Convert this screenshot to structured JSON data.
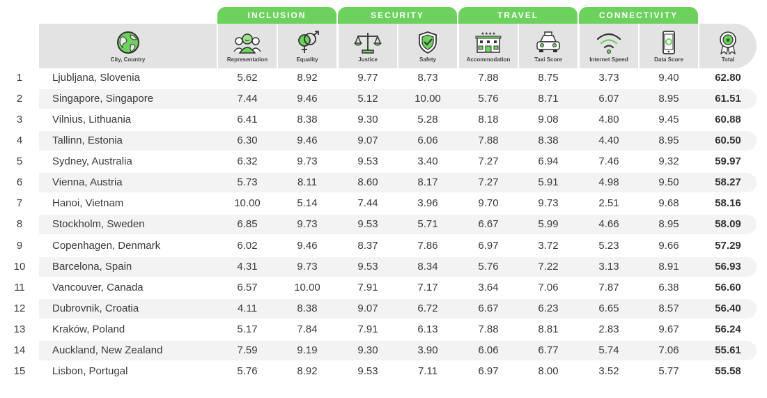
{
  "categories": [
    {
      "label": "INCLUSION"
    },
    {
      "label": "SECURITY"
    },
    {
      "label": "TRAVEL"
    },
    {
      "label": "CONNECTIVITY"
    }
  ],
  "columns": {
    "city": "City, Country",
    "representation": "Representation",
    "equality": "Equality",
    "justice": "Justice",
    "safety": "Safety",
    "accommodation": "Accommodation",
    "taxi": "Taxi Score",
    "internet": "Internet Speed",
    "data": "Data Score",
    "total": "Total"
  },
  "icons": {
    "city": "globe-icon",
    "representation": "people-group-icon",
    "equality": "gender-symbols-icon",
    "justice": "scales-icon",
    "safety": "shield-check-icon",
    "accommodation": "hotel-icon",
    "taxi": "taxi-icon",
    "internet": "wifi-icon",
    "data": "smartphone-icon",
    "total": "award-ribbon-icon"
  },
  "colors": {
    "accent": "#6cd15d",
    "header_bg": "#e3e3e3",
    "band_bg": "#f3f3f3"
  },
  "rows": [
    {
      "rank": "1",
      "city": "Ljubljana, Slovenia",
      "values": [
        "5.62",
        "8.92",
        "9.77",
        "8.73",
        "7.88",
        "8.75",
        "3.73",
        "9.40"
      ],
      "total": "62.80"
    },
    {
      "rank": "2",
      "city": "Singapore, Singapore",
      "values": [
        "7.44",
        "9.46",
        "5.12",
        "10.00",
        "5.76",
        "8.71",
        "6.07",
        "8.95"
      ],
      "total": "61.51"
    },
    {
      "rank": "3",
      "city": "Vilnius, Lithuania",
      "values": [
        "6.41",
        "8.38",
        "9.30",
        "5.28",
        "8.18",
        "9.08",
        "4.80",
        "9.45"
      ],
      "total": "60.88"
    },
    {
      "rank": "4",
      "city": "Tallinn, Estonia",
      "values": [
        "6.30",
        "9.46",
        "9.07",
        "6.06",
        "7.88",
        "8.38",
        "4.40",
        "8.95"
      ],
      "total": "60.50"
    },
    {
      "rank": "5",
      "city": "Sydney, Australia",
      "values": [
        "6.32",
        "9.73",
        "9.53",
        "3.40",
        "7.27",
        "6.94",
        "7.46",
        "9.32"
      ],
      "total": "59.97"
    },
    {
      "rank": "6",
      "city": "Vienna, Austria",
      "values": [
        "5.73",
        "8.11",
        "8.60",
        "8.17",
        "7.27",
        "5.91",
        "4.98",
        "9.50"
      ],
      "total": "58.27"
    },
    {
      "rank": "7",
      "city": "Hanoi, Vietnam",
      "values": [
        "10.00",
        "5.14",
        "7.44",
        "3.96",
        "9.70",
        "9.73",
        "2.51",
        "9.68"
      ],
      "total": "58.16"
    },
    {
      "rank": "8",
      "city": "Stockholm, Sweden",
      "values": [
        "6.85",
        "9.73",
        "9.53",
        "5.71",
        "6.67",
        "5.99",
        "4.66",
        "8.95"
      ],
      "total": "58.09"
    },
    {
      "rank": "9",
      "city": "Copenhagen, Denmark",
      "values": [
        "6.02",
        "9.46",
        "8.37",
        "7.86",
        "6.97",
        "3.72",
        "5.23",
        "9.66"
      ],
      "total": "57.29"
    },
    {
      "rank": "10",
      "city": "Barcelona, Spain",
      "values": [
        "4.31",
        "9.73",
        "9.53",
        "8.34",
        "5.76",
        "7.22",
        "3.13",
        "8.91"
      ],
      "total": "56.93"
    },
    {
      "rank": "11",
      "city": "Vancouver, Canada",
      "values": [
        "6.57",
        "10.00",
        "7.91",
        "7.17",
        "3.64",
        "7.06",
        "7.87",
        "6.38"
      ],
      "total": "56.60"
    },
    {
      "rank": "12",
      "city": "Dubrovnik, Croatia",
      "values": [
        "4.11",
        "8.38",
        "9.07",
        "6.72",
        "6.67",
        "6.23",
        "6.65",
        "8.57"
      ],
      "total": "56.40"
    },
    {
      "rank": "13",
      "city": "Kraków, Poland",
      "values": [
        "5.17",
        "7.84",
        "7.91",
        "6.13",
        "7.88",
        "8.81",
        "2.83",
        "9.67"
      ],
      "total": "56.24"
    },
    {
      "rank": "14",
      "city": "Auckland, New Zealand",
      "values": [
        "7.59",
        "9.19",
        "9.30",
        "3.90",
        "6.06",
        "6.77",
        "5.74",
        "7.06"
      ],
      "total": "55.61"
    },
    {
      "rank": "15",
      "city": "Lisbon, Portugal",
      "values": [
        "5.76",
        "8.92",
        "9.53",
        "7.11",
        "6.97",
        "8.00",
        "3.52",
        "5.77"
      ],
      "total": "55.58"
    }
  ]
}
